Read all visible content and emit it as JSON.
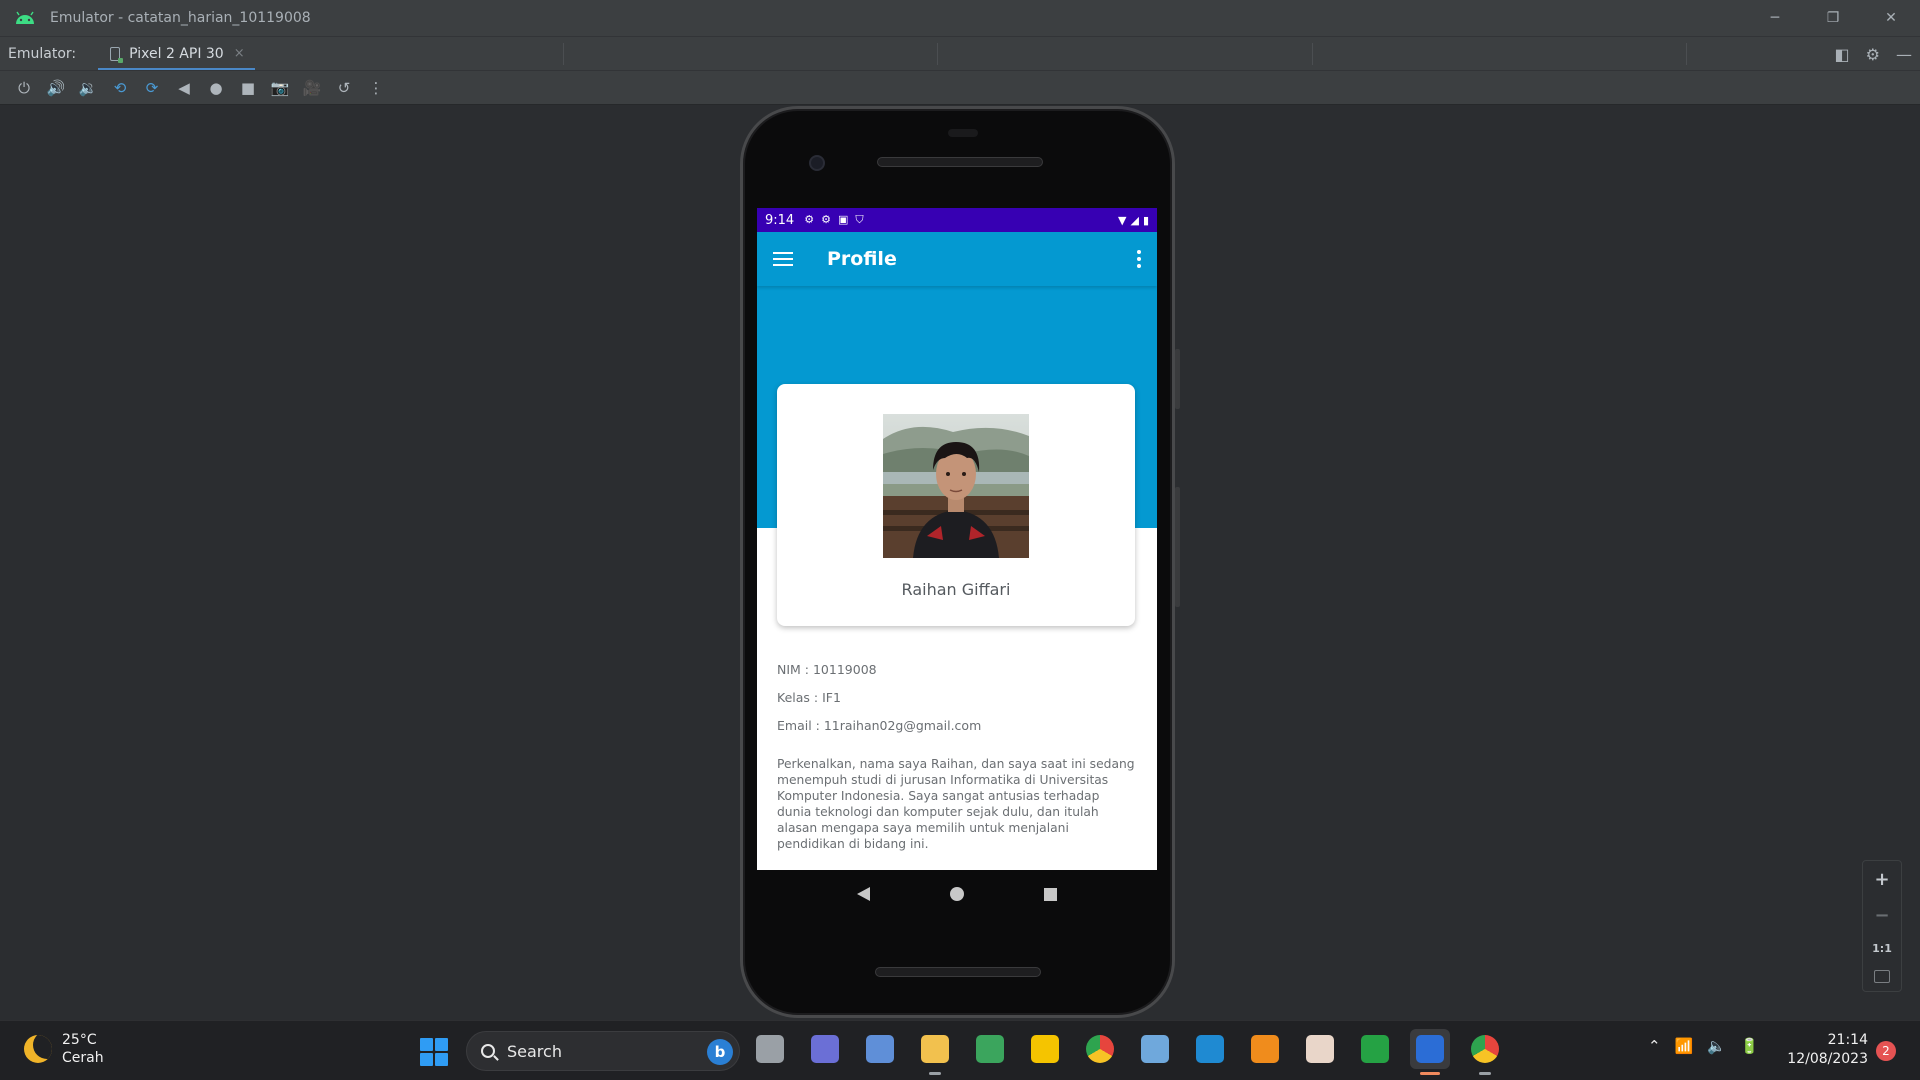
{
  "window": {
    "title": "Emulator - catatan_harian_10119008"
  },
  "tabbar": {
    "label": "Emulator:",
    "device_tab": "Pixel 2 API 30",
    "close_glyph": "×"
  },
  "toolbar": {
    "tools": [
      "power-icon",
      "volume-up-icon",
      "volume-down-icon",
      "rotate-left-icon",
      "rotate-right-icon",
      "back-icon",
      "home-icon",
      "overview-icon",
      "screenshot-icon",
      "screen-record-icon",
      "snapshot-icon",
      "more-icon"
    ]
  },
  "device": {
    "status_bar": {
      "time": "9:14",
      "color": "#3700b3"
    },
    "app_bar": {
      "title": "Profile",
      "color": "#0499d1"
    },
    "profile": {
      "name": "Raihan Giffari",
      "nim": "NIM : 10119008",
      "kelas": "Kelas : IF1",
      "email": "Email : 11raihan02g@gmail.com",
      "description": "Perkenalkan, nama saya Raihan, dan saya saat ini sedang menempuh studi di jurusan Informatika di Universitas Komputer Indonesia. Saya sangat antusias terhadap dunia teknologi dan komputer sejak dulu, dan itulah alasan mengapa saya memilih untuk menjalani pendidikan di bidang ini."
    }
  },
  "zoom": {
    "plus": "+",
    "minus": "−",
    "one_to_one": "1:1"
  },
  "taskbar": {
    "weather": {
      "temp": "25°C",
      "condition": "Cerah"
    },
    "search_label": "Search",
    "bing_glyph": "b",
    "clock": {
      "time": "21:14",
      "date": "12/08/2023"
    },
    "notification_count": "2",
    "apps": [
      {
        "name": "file-explorer-icon",
        "color": "#9aa0a6"
      },
      {
        "name": "teams-chat-icon",
        "color": "#6b6fd6"
      },
      {
        "name": "settings-gear-icon",
        "color": "#5f8fd8"
      },
      {
        "name": "folder-icon",
        "color": "#f2c14e"
      },
      {
        "name": "network-globe-icon",
        "color": "#3ba55d"
      },
      {
        "name": "warning-app-icon",
        "color": "#f5c400"
      },
      {
        "name": "chrome-icon",
        "color": "#e6453d"
      },
      {
        "name": "resource-monitor-icon",
        "color": "#6fa8dc"
      },
      {
        "name": "vscode-icon",
        "color": "#1f8ad2"
      },
      {
        "name": "vlc-icon",
        "color": "#f08c1c"
      },
      {
        "name": "anime-app-icon",
        "color": "#e9d6c9"
      },
      {
        "name": "green-diamond-icon",
        "color": "#25a244"
      },
      {
        "name": "word-app-icon",
        "color": "#2b6dd6"
      },
      {
        "name": "chrome-profile-icon",
        "color": "#e6453d"
      }
    ]
  }
}
